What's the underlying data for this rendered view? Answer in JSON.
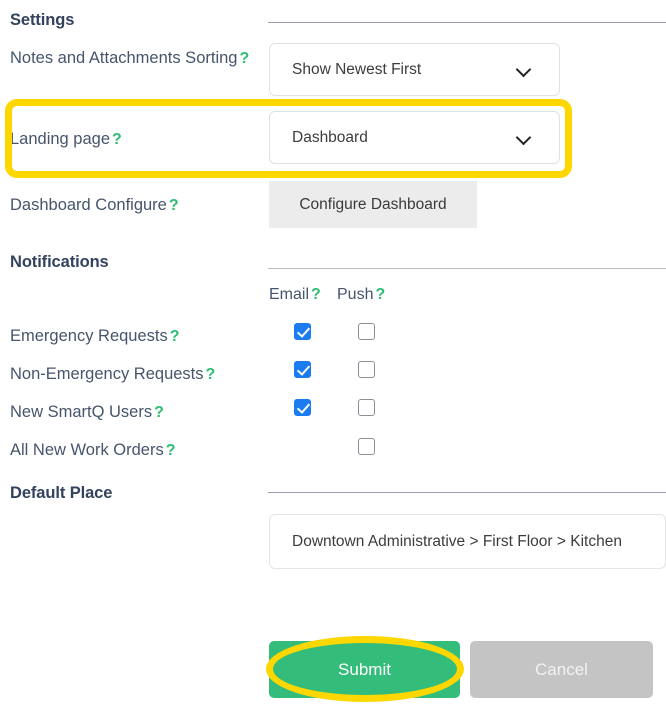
{
  "sections": {
    "settings_title": "Settings",
    "notifications_title": "Notifications",
    "default_place_title": "Default Place"
  },
  "settings": {
    "sorting": {
      "label": "Notes and Attachments Sorting",
      "help": "?",
      "value": "Show Newest First"
    },
    "landing_page": {
      "label": "Landing page",
      "help": "?",
      "value": "Dashboard"
    },
    "dashboard_configure": {
      "label": "Dashboard Configure",
      "help": "?",
      "button_label": "Configure Dashboard"
    }
  },
  "notifications": {
    "columns": [
      {
        "label": "Email",
        "help": "?"
      },
      {
        "label": "Push",
        "help": "?"
      }
    ],
    "rows": [
      {
        "label": "Emergency Requests",
        "help": "?",
        "email": true,
        "email_present": true,
        "push": false,
        "push_present": true
      },
      {
        "label": "Non-Emergency Requests",
        "help": "?",
        "email": true,
        "email_present": true,
        "push": false,
        "push_present": true
      },
      {
        "label": "New SmartQ Users",
        "help": "?",
        "email": true,
        "email_present": true,
        "push": false,
        "push_present": true
      },
      {
        "label": "All New Work Orders",
        "help": "?",
        "email": false,
        "email_present": false,
        "push": false,
        "push_present": true
      }
    ]
  },
  "default_place": {
    "value": "Downtown Administrative > First Floor > Kitchen"
  },
  "actions": {
    "submit_label": "Submit",
    "cancel_label": "Cancel"
  },
  "colors": {
    "accent_green": "#34bd7a",
    "highlight_yellow": "#fed700",
    "checkbox_blue": "#1a7cf0",
    "cancel_grey": "#c4c4c4",
    "text_navy": "#33435d",
    "help_green": "#2ebd72"
  }
}
